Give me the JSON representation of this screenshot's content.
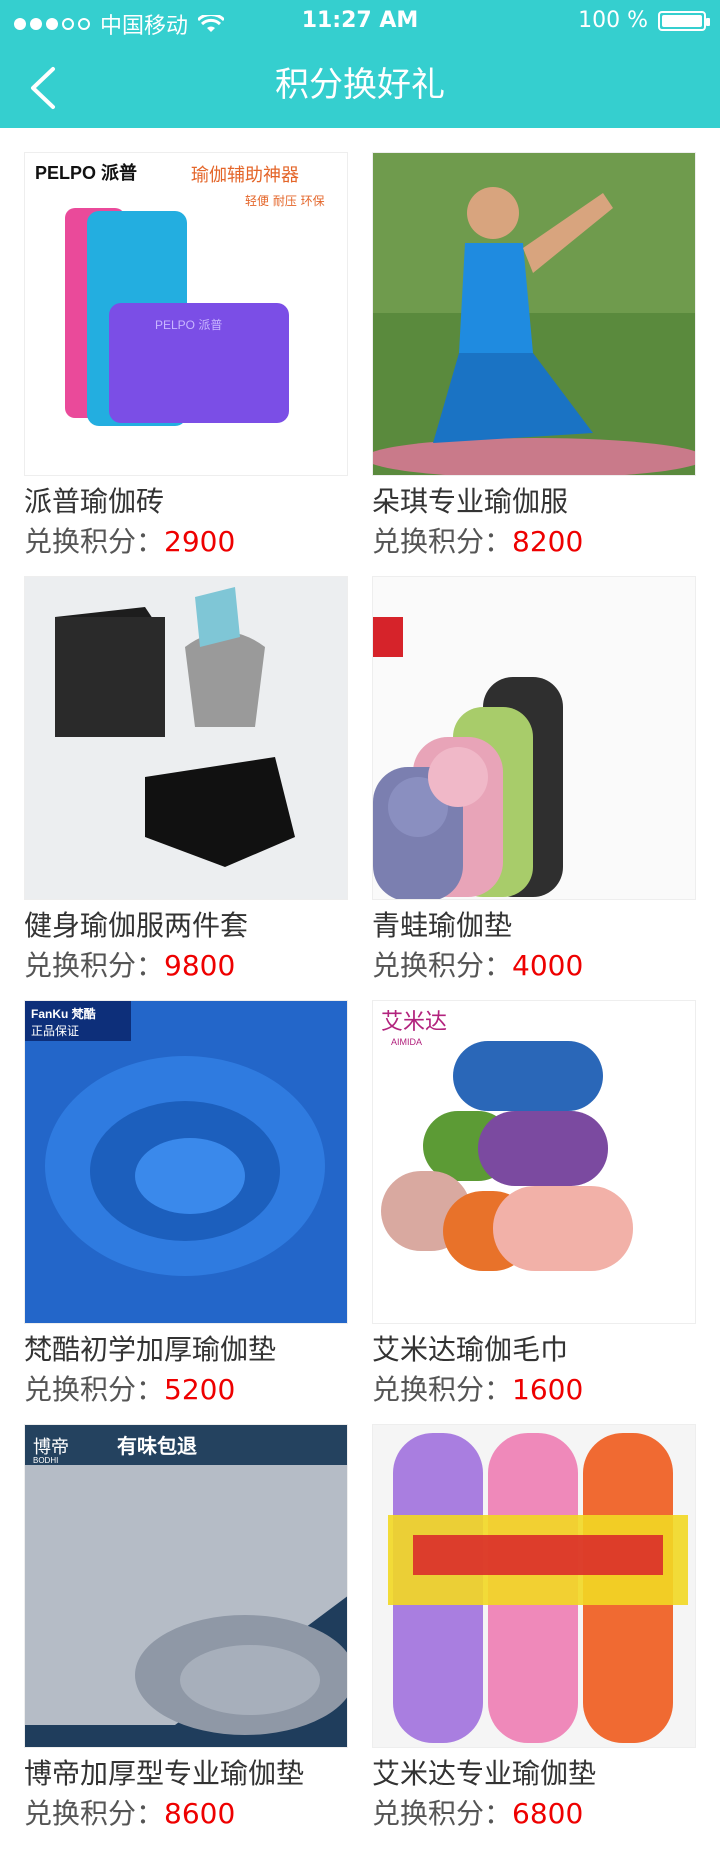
{
  "status_bar": {
    "carrier": "中国移动",
    "time": "11:27 AM",
    "battery": "100 %"
  },
  "header": {
    "title": "积分换好礼"
  },
  "products": [
    {
      "name": "派普瑜伽砖",
      "points_label": "兑换积分：",
      "points": "2900",
      "image_text": "PELPO 派普 瑜伽辅助神器"
    },
    {
      "name": "朵琪专业瑜伽服",
      "points_label": "兑换积分：",
      "points": "8200",
      "image_text": ""
    },
    {
      "name": "健身瑜伽服两件套",
      "points_label": "兑换积分：",
      "points": "9800",
      "image_text": ""
    },
    {
      "name": "青蛙瑜伽垫",
      "points_label": "兑换积分：",
      "points": "4000",
      "image_text": ""
    },
    {
      "name": "梵酷初学加厚瑜伽垫",
      "points_label": "兑换积分：",
      "points": "5200",
      "image_text": "FanKu 梵酷 正品保证"
    },
    {
      "name": "艾米达瑜伽毛巾",
      "points_label": "兑换积分：",
      "points": "1600",
      "image_text": "艾米达 AIMIDA"
    },
    {
      "name": "博帝加厚型专业瑜伽垫",
      "points_label": "兑换积分：",
      "points": "8600",
      "image_text": "博帝 BODHI 有味包退"
    },
    {
      "name": "艾米达专业瑜伽垫",
      "points_label": "兑换积分：",
      "points": "6800",
      "image_text": ""
    }
  ]
}
